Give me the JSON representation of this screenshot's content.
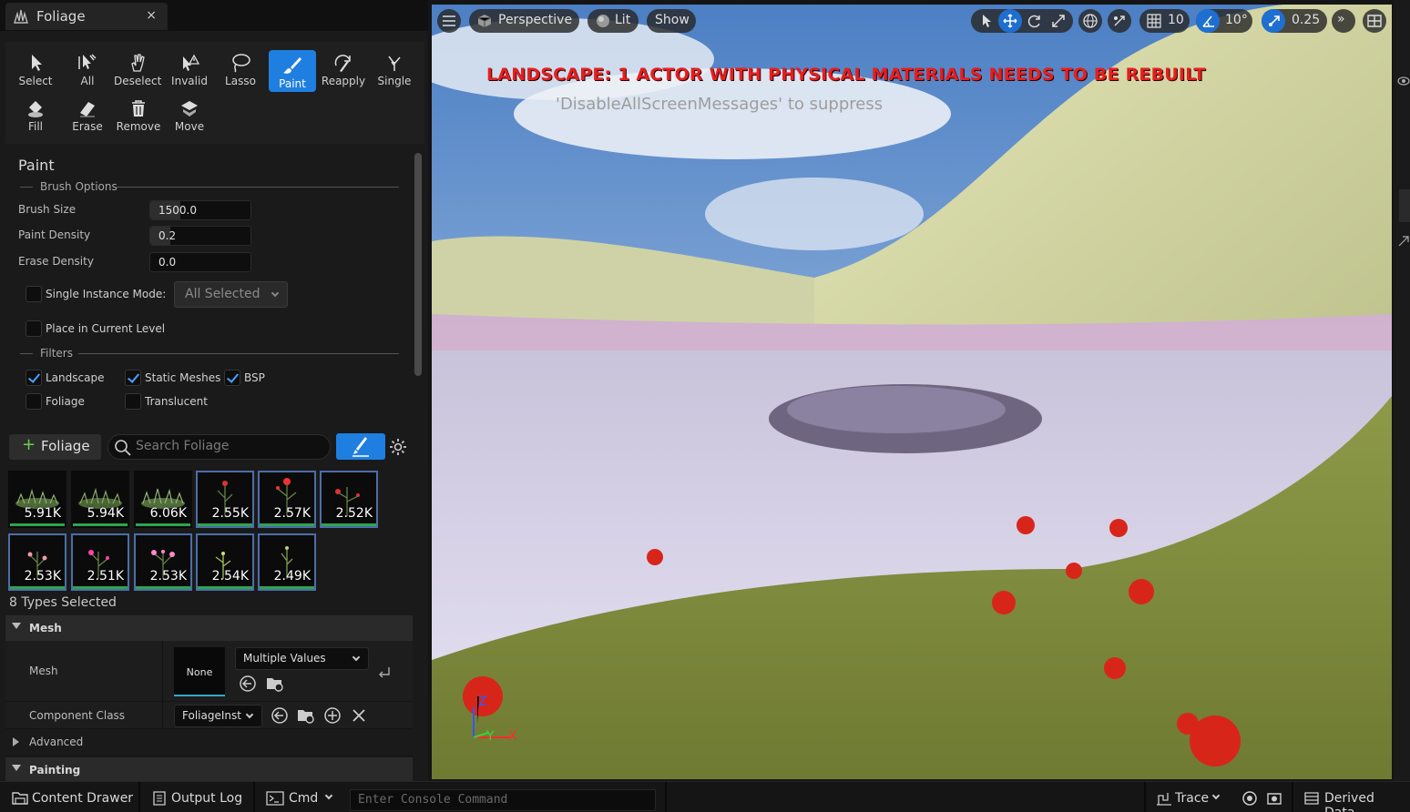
{
  "tab": {
    "title": "Foliage",
    "close": "×"
  },
  "modes": [
    {
      "label": "Select",
      "icon": "select-arrow-icon"
    },
    {
      "label": "All",
      "icon": "select-all-icon"
    },
    {
      "label": "Deselect",
      "icon": "deselect-hand-icon"
    },
    {
      "label": "Invalid",
      "icon": "invalid-warning-icon"
    },
    {
      "label": "Lasso",
      "icon": "lasso-icon"
    },
    {
      "label": "Paint",
      "icon": "paint-brush-icon",
      "active": true
    },
    {
      "label": "Reapply",
      "icon": "reapply-icon"
    },
    {
      "label": "Single",
      "icon": "single-foliage-icon"
    },
    {
      "label": "Fill",
      "icon": "fill-bucket-icon"
    },
    {
      "label": "Erase",
      "icon": "eraser-icon"
    },
    {
      "label": "Remove",
      "icon": "trash-icon"
    },
    {
      "label": "Move",
      "icon": "move-icon"
    }
  ],
  "paint": {
    "title": "Paint",
    "brush_options": "Brush Options",
    "brush_size_label": "Brush Size",
    "brush_size": "1500.0",
    "brush_size_fill": 0.3,
    "paint_density_label": "Paint Density",
    "paint_density": "0.2",
    "paint_density_fill": 0.2,
    "erase_density_label": "Erase Density",
    "erase_density": "0.0",
    "single_instance_label": "Single Instance Mode:",
    "single_instance_value": "All Selected",
    "place_in_level_label": "Place in Current Level",
    "filters": "Filters",
    "filter_landscape": "Landscape",
    "filter_static": "Static Meshes",
    "filter_bsp": "BSP",
    "filter_foliage": "Foliage",
    "filter_translucent": "Translucent"
  },
  "palette": {
    "add_label": "Foliage",
    "search_placeholder": "Search Foliage",
    "items": [
      "5.91K",
      "5.94K",
      "6.06K",
      "2.55K",
      "2.57K",
      "2.52K",
      "2.53K",
      "2.51K",
      "2.53K",
      "2.54K",
      "2.49K"
    ],
    "types_selected": "8 Types Selected"
  },
  "details": {
    "mesh_category": "Mesh",
    "mesh_label": "Mesh",
    "mesh_preview": "None",
    "mesh_value": "Multiple Values",
    "component_class_label": "Component Class",
    "component_class_value": "FoliageInst",
    "advanced": "Advanced",
    "painting": "Painting"
  },
  "viewport": {
    "perspective": "Perspective",
    "lit": "Lit",
    "show": "Show",
    "grid_snap": "10",
    "rotation_snap": "10°",
    "scale_snap": "0.25",
    "warning": "LANDSCAPE: 1 ACTOR WITH PHYSICAL MATERIALS NEEDS TO BE REBUILT",
    "suppress": "'DisableAllScreenMessages' to suppress",
    "axis_z": "Z",
    "axis_y": "Y",
    "axis_x": "X"
  },
  "bottom": {
    "content_drawer": "Content Drawer",
    "output_log": "Output Log",
    "cmd": "Cmd",
    "console_placeholder": "Enter Console Command",
    "trace": "Trace",
    "derived_data": "Derived Data"
  }
}
